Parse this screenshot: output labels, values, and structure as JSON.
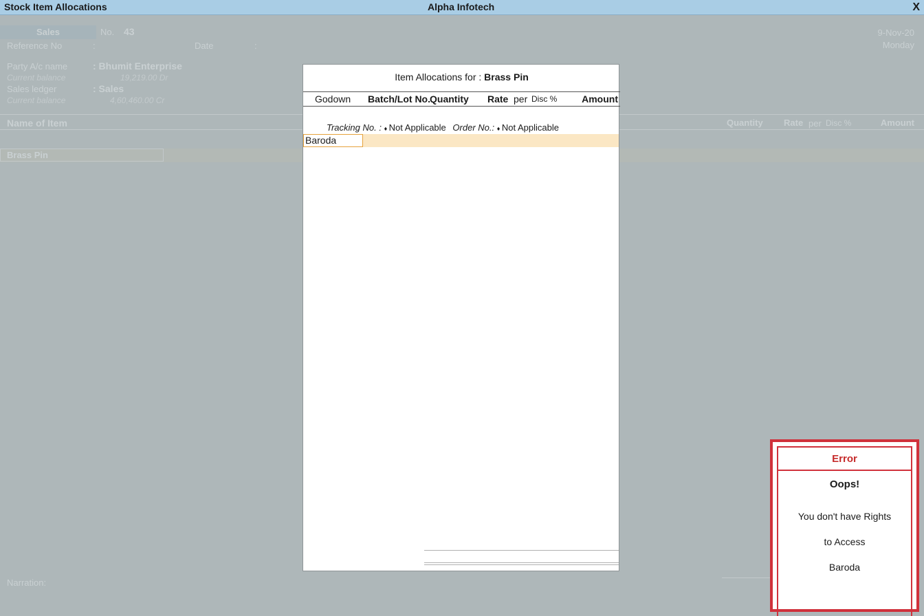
{
  "window": {
    "title_left": "Stock Item Allocations",
    "title_center": "Alpha Infotech",
    "close_symbol": "X"
  },
  "voucher": {
    "type": "Sales",
    "no_label": "No.",
    "no_value": "43",
    "date_short": "9-Nov-20",
    "day": "Monday",
    "reference_label": "Reference No",
    "reference_sep": ":",
    "date_label": "Date",
    "date_sep": ":",
    "party_label": "Party A/c name",
    "party_value": ": Bhumit Enterprise",
    "party_balance_label": "Current balance",
    "party_balance_value": "19,219.00 Dr",
    "sales_ledger_label": "Sales ledger",
    "sales_ledger_value": ": Sales",
    "sales_balance_label": "Current balance",
    "sales_balance_value": "4,60,460.00 Cr",
    "header_name_of_item": "Name of Item",
    "header_quantity": "Quantity",
    "header_rate": "Rate",
    "header_per": "per",
    "header_disc": "Disc %",
    "header_amount": "Amount",
    "stock_item": "Brass Pin",
    "narration_label": "Narration:"
  },
  "modal": {
    "title_prefix": "Item Allocations for :",
    "title_item": "Brass Pin",
    "columns": {
      "godown": "Godown",
      "batch": "Batch/Lot No.",
      "quantity": "Quantity",
      "rate": "Rate",
      "per": "per",
      "disc": "Disc %",
      "amount": "Amount"
    },
    "tracking_label": "Tracking No. :",
    "tracking_value": "Not Applicable",
    "order_label": "Order No.:",
    "order_value": "Not Applicable",
    "godown_value": "Baroda"
  },
  "error": {
    "title": "Error",
    "heading": "Oops!",
    "line1": "You don't have Rights",
    "line2": "to Access",
    "line3": "Baroda"
  },
  "colors": {
    "titlebar": "#a9cde5",
    "background": "#aeb7b9",
    "error_red": "#d0313b",
    "highlight_row": "#fbe7c4"
  }
}
